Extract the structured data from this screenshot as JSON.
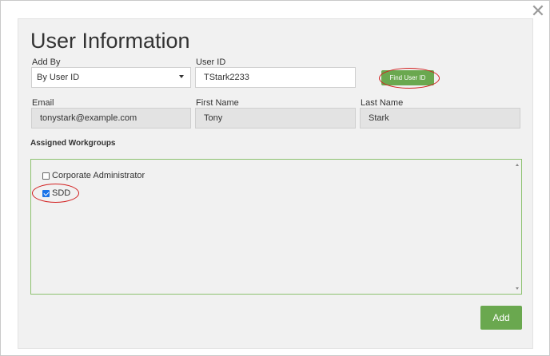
{
  "dialog": {
    "close_glyph": "✕",
    "title": "User Information"
  },
  "form": {
    "add_by": {
      "label": "Add By",
      "value": "By User ID"
    },
    "user_id": {
      "label": "User ID",
      "value": "TStark2233"
    },
    "find_button": "Find User ID",
    "email": {
      "label": "Email",
      "value": "tonystark@example.com"
    },
    "first_name": {
      "label": "First Name",
      "value": "Tony"
    },
    "last_name": {
      "label": "Last Name",
      "value": "Stark"
    }
  },
  "workgroups": {
    "title": "Assigned Workgroups",
    "items": [
      {
        "label": "Corporate Administrator",
        "checked": false
      },
      {
        "label": "SDD",
        "checked": true
      }
    ]
  },
  "actions": {
    "add_button": "Add"
  },
  "colors": {
    "accent_green": "#6aa84f",
    "annotation_red": "#d21f1f",
    "panel_bg": "#f1f1f1"
  }
}
